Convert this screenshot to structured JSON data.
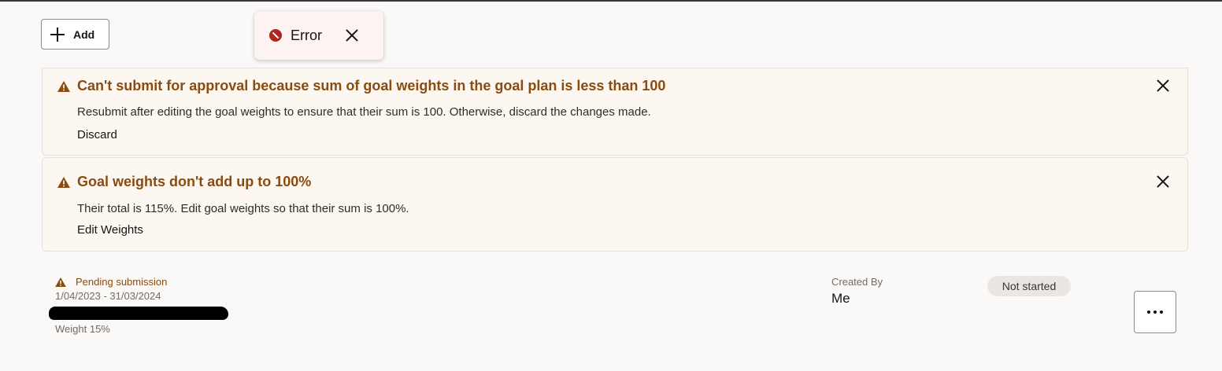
{
  "toolbar": {
    "add_label": "Add"
  },
  "toast": {
    "title": "Error"
  },
  "messages": [
    {
      "title": "Can't submit for approval because sum of goal weights in the goal plan is less than 100",
      "body": "Resubmit after editing the goal weights to ensure that their sum is 100. Otherwise, discard the changes made.",
      "action": "Discard"
    },
    {
      "title": "Goal weights don't add up to 100%",
      "body": "Their total is 115%. Edit goal weights so that their sum is 100%.",
      "action": "Edit Weights"
    }
  ],
  "goal": {
    "status": "Pending submission",
    "dates": "1/04/2023 - 31/03/2024",
    "weight": "Weight 15%",
    "created_by_label": "Created By",
    "created_by_value": "Me",
    "progress_badge": "Not started"
  },
  "colors": {
    "warning": "#8a4b0f",
    "error": "#b3241d",
    "message_bg": "#fdf7f1",
    "page_bg": "#fbf9f8"
  },
  "icons": [
    "plus-icon",
    "error-icon",
    "close-icon",
    "warning-icon",
    "more-icon"
  ]
}
